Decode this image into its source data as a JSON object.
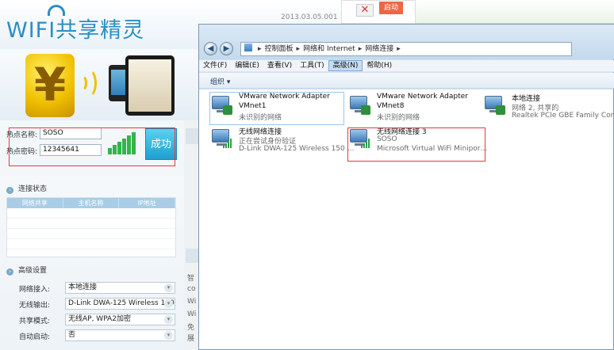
{
  "app": {
    "logo_text": "WIFI共享精灵",
    "version": "2013.03.05.001",
    "promo_button": "启动",
    "promo_close": "✕",
    "banner_symbol": "¥",
    "hotspot": {
      "name_label": "热点名称:",
      "name_value": "SOSO",
      "password_label": "热点密码:",
      "password_value": "12345641",
      "connect_button": "成功"
    },
    "connection_status": {
      "header": "连接状态",
      "columns": [
        "网络共享",
        "主机名称",
        "IP地址"
      ]
    },
    "advanced": {
      "header": "高级设置",
      "rows": [
        {
          "label": "网络接入:",
          "value": "本地连接"
        },
        {
          "label": "无线输出:",
          "value": "D-Link DWA-125 Wireless 150"
        },
        {
          "label": "共享模式:",
          "value": "无线AP, WPA2加密"
        },
        {
          "label": "自动启动:",
          "value": "否"
        }
      ]
    },
    "side_text": [
      "智",
      "co",
      "Wi",
      "Wi",
      "免",
      "展"
    ]
  },
  "explorer": {
    "breadcrumb": [
      "控制面板",
      "网络和 Internet",
      "网络连接"
    ],
    "menu": [
      "文件(F)",
      "编辑(E)",
      "查看(V)",
      "工具(T)",
      "高级(N)",
      "帮助(H)"
    ],
    "active_menu": "高级(N)",
    "organize": "组织 ▾",
    "connections": [
      {
        "id": "vmnet1",
        "title": "VMware Network Adapter",
        "line1": "VMnet1",
        "line2": "未识别的网络",
        "icon": "wired-network-icon"
      },
      {
        "id": "vmnet8",
        "title": "VMware Network Adapter",
        "line1": "VMnet8",
        "line2": "未识别的网络",
        "icon": "wired-network-icon"
      },
      {
        "id": "local",
        "title": "本地连接",
        "line1": "网络  2, 共享的",
        "line2": "Realtek PCIe GBE Family Contr…",
        "icon": "wired-network-icon"
      },
      {
        "id": "wireless",
        "title": "无线网络连接",
        "line1": "正在尝试身份验证",
        "line2": "D-Link DWA-125 Wireless 150 …",
        "icon": "wireless-network-icon"
      },
      {
        "id": "wireless3",
        "title": "无线网络连接 3",
        "line1": "SOSO",
        "line2": "Microsoft Virtual WiFi Minipor…",
        "icon": "wireless-network-icon"
      }
    ]
  },
  "colors": {
    "accent_blue": "#2a8ec4",
    "highlight_red": "#e53b3b",
    "signal_green": "#33b44a"
  }
}
